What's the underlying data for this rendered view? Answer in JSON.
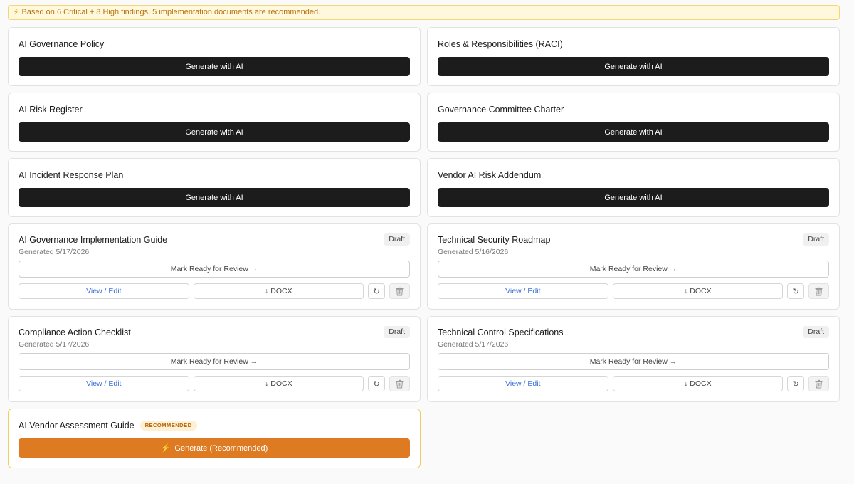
{
  "banner": {
    "icon": "lightning-icon",
    "text": "Based on 6 Critical + 8 High findings, 5 implementation documents are recommended."
  },
  "ungenerated": [
    {
      "title": "AI Governance Policy",
      "button": "Generate with AI"
    },
    {
      "title": "Roles & Responsibilities (RACI)",
      "button": "Generate with AI"
    },
    {
      "title": "AI Risk Register",
      "button": "Generate with AI"
    },
    {
      "title": "Governance Committee Charter",
      "button": "Generate with AI"
    },
    {
      "title": "AI Incident Response Plan",
      "button": "Generate with AI"
    },
    {
      "title": "Vendor AI Risk Addendum",
      "button": "Generate with AI"
    }
  ],
  "generated": [
    {
      "title": "AI Governance Implementation Guide",
      "status": "Draft",
      "date": "Generated 5/17/2026",
      "review": "Mark Ready for Review →",
      "view": "View / Edit",
      "docx": "↓ DOCX",
      "regen_icon": "refresh-icon",
      "delete_icon": "trash-icon"
    },
    {
      "title": "Technical Security Roadmap",
      "status": "Draft",
      "date": "Generated 5/16/2026",
      "review": "Mark Ready for Review →",
      "view": "View / Edit",
      "docx": "↓ DOCX",
      "regen_icon": "refresh-icon",
      "delete_icon": "trash-icon"
    },
    {
      "title": "Compliance Action Checklist",
      "status": "Draft",
      "date": "Generated 5/17/2026",
      "review": "Mark Ready for Review →",
      "view": "View / Edit",
      "docx": "↓ DOCX",
      "regen_icon": "refresh-icon",
      "delete_icon": "trash-icon"
    },
    {
      "title": "Technical Control Specifications",
      "status": "Draft",
      "date": "Generated 5/17/2026",
      "review": "Mark Ready for Review →",
      "view": "View / Edit",
      "docx": "↓ DOCX",
      "regen_icon": "refresh-icon",
      "delete_icon": "trash-icon"
    }
  ],
  "recommended": {
    "title": "AI Vendor Assessment Guide",
    "badge": "RECOMMENDED",
    "button": "Generate (Recommended)",
    "button_icon": "lightning-icon"
  },
  "colors": {
    "dark_button": "#1c1c1c",
    "accent_orange": "#dd7a22",
    "banner_bg": "#fff8dc",
    "link_blue": "#3a6fd8"
  }
}
